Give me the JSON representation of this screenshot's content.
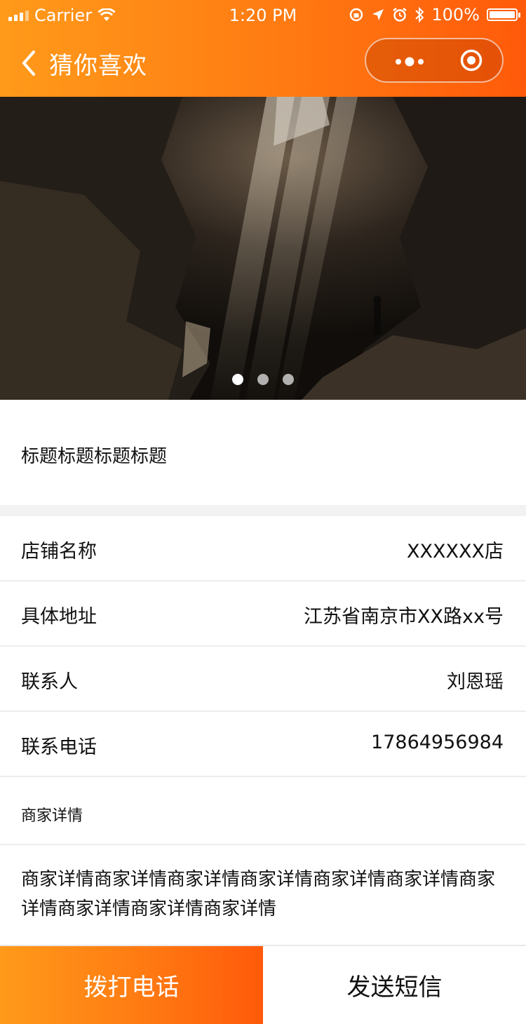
{
  "status_bar": {
    "carrier": "Carrier",
    "time": "1:20 PM",
    "battery": "100%"
  },
  "nav": {
    "title": "猜你喜欢"
  },
  "banner": {
    "image": "cave-light-rays",
    "slides": 3,
    "active_slide": 1
  },
  "title": "标题标题标题标题",
  "info": [
    {
      "label": "店铺名称",
      "value": "XXXXXX店"
    },
    {
      "label": "具体地址",
      "value": "江苏省南京市XX路xx号"
    },
    {
      "label": "联系人",
      "value": "刘恩瑶"
    },
    {
      "label": "联系电话",
      "value": "17864956984"
    }
  ],
  "details": {
    "heading": "商家详情",
    "body": "商家详情商家详情商家详情商家详情商家详情商家详情商家详情商家详情商家详情商家详情"
  },
  "actions": {
    "call": "拨打电话",
    "sms": "发送短信"
  },
  "colors": {
    "accent_start": "#ff9a1a",
    "accent_end": "#ff5a0a",
    "separator": "#f2f2f2"
  }
}
